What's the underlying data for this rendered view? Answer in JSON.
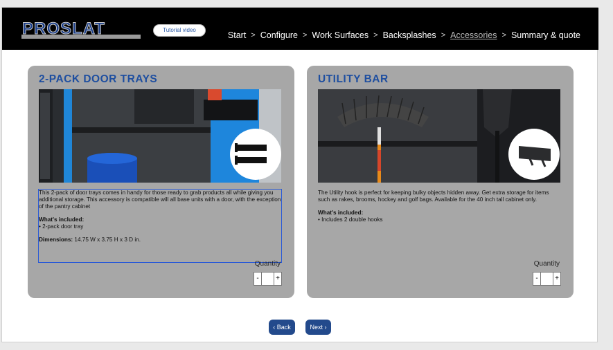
{
  "header": {
    "logo_text": "PROSLAT",
    "tutorial_label": "Tutorial video",
    "nav": [
      {
        "label": "Start",
        "active": false
      },
      {
        "label": "Configure",
        "active": false
      },
      {
        "label": "Work Surfaces",
        "active": false
      },
      {
        "label": "Backsplashes",
        "active": false
      },
      {
        "label": "Accessories",
        "active": true
      },
      {
        "label": "Summary & quote",
        "active": false
      }
    ],
    "nav_separator": ">"
  },
  "products": [
    {
      "title": "2-PACK DOOR TRAYS",
      "description": "This 2-pack of door trays comes in handy for those ready to grab products all while giving you additional storage. This accessory is compatible will all base units with a door, with the exception of the pantry cabinet",
      "included_heading": "What's included:",
      "included_items": [
        "• 2-pack door tray"
      ],
      "dimensions_label": "Dimensions:",
      "dimensions_value": " 14.75 W x 3.75 H x 3 D in.",
      "quantity_label": "Quantity",
      "quantity_value": "",
      "minus": "-",
      "plus": "+"
    },
    {
      "title": "UTILITY BAR",
      "description": "The Utility hook is perfect for keeping bulky objects hidden away. Get extra storage for items such as rakes, brooms, hockey and golf bags. Available for the 40 inch tall cabinet only.",
      "included_heading": "What's included:",
      "included_items": [
        "• Includes 2 double hooks"
      ],
      "quantity_label": "Quantity",
      "quantity_value": "",
      "minus": "-",
      "plus": "+"
    }
  ],
  "footer": {
    "back_label": "‹ Back",
    "next_label": "Next ›"
  },
  "colors": {
    "accent_blue": "#1f4fa0",
    "button_blue": "#234a8c",
    "card_gray": "#a7a7a7",
    "header_black": "#000000"
  }
}
